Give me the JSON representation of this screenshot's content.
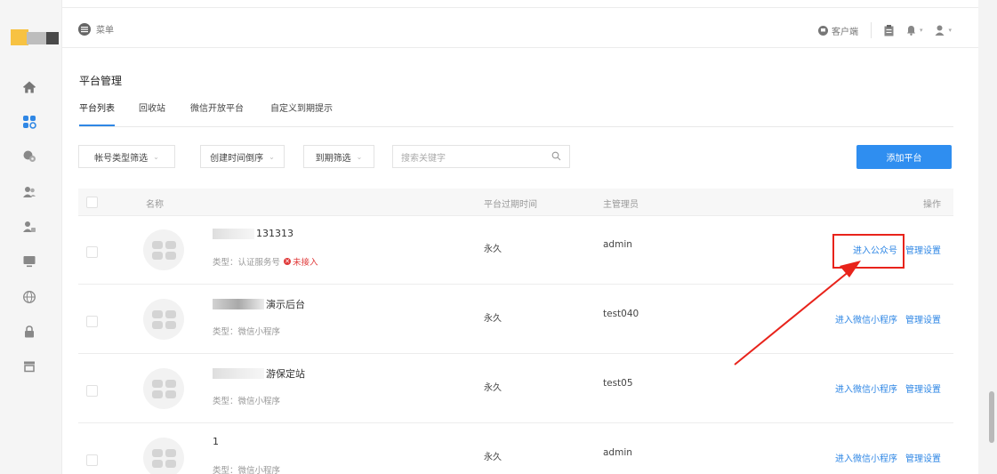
{
  "topbar": {
    "menu_label": "菜单",
    "client_label": "客户端"
  },
  "page": {
    "title": "平台管理"
  },
  "tabs": [
    {
      "label": "平台列表",
      "active": true
    },
    {
      "label": "回收站",
      "active": false
    },
    {
      "label": "微信开放平台",
      "active": false
    },
    {
      "label": "自定义到期提示",
      "active": false
    }
  ],
  "filters": {
    "account_type": "帐号类型筛选",
    "created_sort": "创建时间倒序",
    "expire_filter": "到期筛选",
    "search_placeholder": "搜索关键字",
    "add_button": "添加平台"
  },
  "table": {
    "headers": {
      "name": "名称",
      "expire": "平台过期时间",
      "admin": "主管理员",
      "ops": "操作"
    },
    "rows": [
      {
        "name": "131313",
        "type": "类型：认证服务号",
        "status": "未接入",
        "expire": "永久",
        "admin": "admin",
        "op1": "进入公众号",
        "op2": "管理设置"
      },
      {
        "name": "演示后台",
        "type": "类型：微信小程序",
        "expire": "永久",
        "admin": "test040",
        "op1": "进入微信小程序",
        "op2": "管理设置"
      },
      {
        "name": "游保定站",
        "type": "类型：微信小程序",
        "expire": "永久",
        "admin": "test05",
        "op1": "进入微信小程序",
        "op2": "管理设置"
      },
      {
        "name": "1",
        "type": "类型：微信小程序",
        "expire": "永久",
        "admin": "admin",
        "op1": "进入微信小程序",
        "op2": "管理设置"
      }
    ]
  },
  "colors": {
    "accent": "#2f87e5",
    "button": "#2f8ef0",
    "annotation": "#e8231b",
    "warning": "#e03a3a"
  },
  "icons": [
    "home-icon",
    "apps-icon",
    "settings-gear-icon",
    "users-icon",
    "user-manage-icon",
    "monitor-icon",
    "globe-icon",
    "lock-icon",
    "store-icon",
    "menu-icon",
    "client-icon",
    "clipboard-icon",
    "bell-icon",
    "user-icon",
    "search-icon"
  ]
}
